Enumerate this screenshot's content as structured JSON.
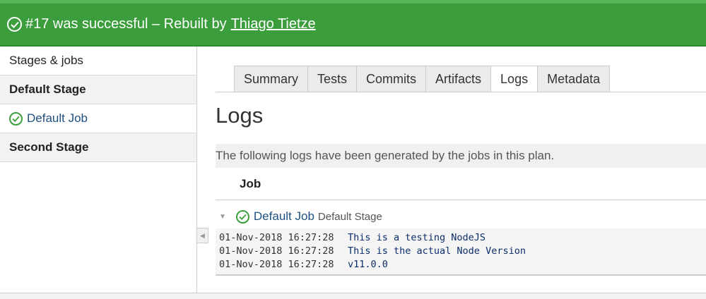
{
  "banner": {
    "status_text": "#17 was successful – Rebuilt by",
    "user_link": "Thiago Tietze",
    "color": "#3b9d3b",
    "icon": "check-circle-icon"
  },
  "sidebar": {
    "header": "Stages & jobs",
    "items": [
      {
        "type": "stage",
        "label": "Default Stage"
      },
      {
        "type": "job",
        "label": "Default Job",
        "icon": "check-circle-icon"
      },
      {
        "type": "stage",
        "label": "Second Stage"
      }
    ]
  },
  "tabs": [
    {
      "label": "Summary",
      "active": false
    },
    {
      "label": "Tests",
      "active": false
    },
    {
      "label": "Commits",
      "active": false
    },
    {
      "label": "Artifacts",
      "active": false
    },
    {
      "label": "Logs",
      "active": true
    },
    {
      "label": "Metadata",
      "active": false
    }
  ],
  "main": {
    "heading": "Logs",
    "description": "The following logs have been generated by the jobs in this plan.",
    "column_header": "Job",
    "job": {
      "name": "Default Job",
      "stage": "Default Stage",
      "icon": "check-circle-icon",
      "expand_icon": "caret-down-icon"
    },
    "log_lines": [
      {
        "timestamp": "01-Nov-2018 16:27:28",
        "message": "This is a testing NodeJS"
      },
      {
        "timestamp": "01-Nov-2018 16:27:28",
        "message": "This is the actual Node Version"
      },
      {
        "timestamp": "01-Nov-2018 16:27:28",
        "message": "v11.0.0"
      }
    ]
  },
  "colors": {
    "success_green": "#3b9d3b",
    "link_blue": "#205081"
  }
}
